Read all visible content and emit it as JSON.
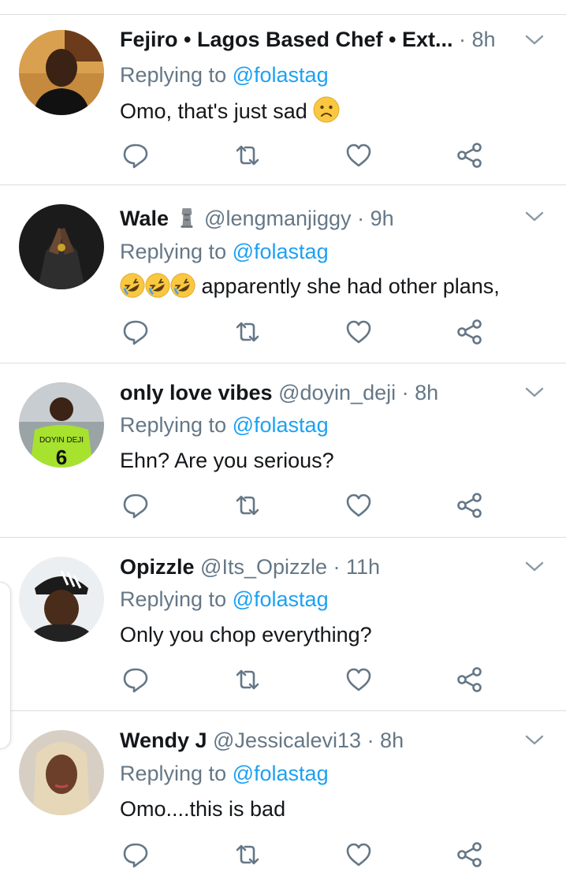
{
  "tweets": [
    {
      "name": "Fejiro • Lagos Based Chef • Ext...",
      "handle": "",
      "time": "· 8h",
      "replying_prefix": "Replying to",
      "replying_handle": "@folastag",
      "text": "Omo, that's just sad",
      "emoji_before": "",
      "emoji_after": "worried-face",
      "has_badge": false
    },
    {
      "name": "Wale",
      "handle": "@lengmanjiggy",
      "time": "· 9h",
      "replying_prefix": "Replying to",
      "replying_handle": "@folastag",
      "text": "apparently she had other plans,",
      "emoji_before": "rolling-laughing x3",
      "emoji_after": "",
      "has_badge": true,
      "badge_icon": "moai-icon"
    },
    {
      "name": "only love vibes",
      "handle": "@doyin_deji",
      "time": "· 8h",
      "replying_prefix": "Replying to",
      "replying_handle": "@folastag",
      "text": "Ehn? Are you serious?",
      "emoji_before": "",
      "emoji_after": "",
      "has_badge": false
    },
    {
      "name": "Opizzle",
      "handle": "@Its_Opizzle",
      "time": "· 11h",
      "replying_prefix": "Replying to",
      "replying_handle": "@folastag",
      "text": "Only you chop everything?",
      "emoji_before": "",
      "emoji_after": "",
      "has_badge": false
    },
    {
      "name": "Wendy J",
      "handle": "@Jessicalevi13",
      "time": "· 8h",
      "replying_prefix": "Replying to",
      "replying_handle": "@folastag",
      "text": "Omo....this is bad",
      "emoji_before": "",
      "emoji_after": "",
      "has_badge": false
    }
  ],
  "icons": {
    "reply": "reply-icon",
    "retweet": "retweet-icon",
    "like": "heart-icon",
    "share": "share-icon",
    "menu": "chevron-down-icon"
  },
  "colors": {
    "text_primary": "#14171a",
    "text_secondary": "#657786",
    "accent": "#1da1f2",
    "divider": "#dadde1"
  }
}
